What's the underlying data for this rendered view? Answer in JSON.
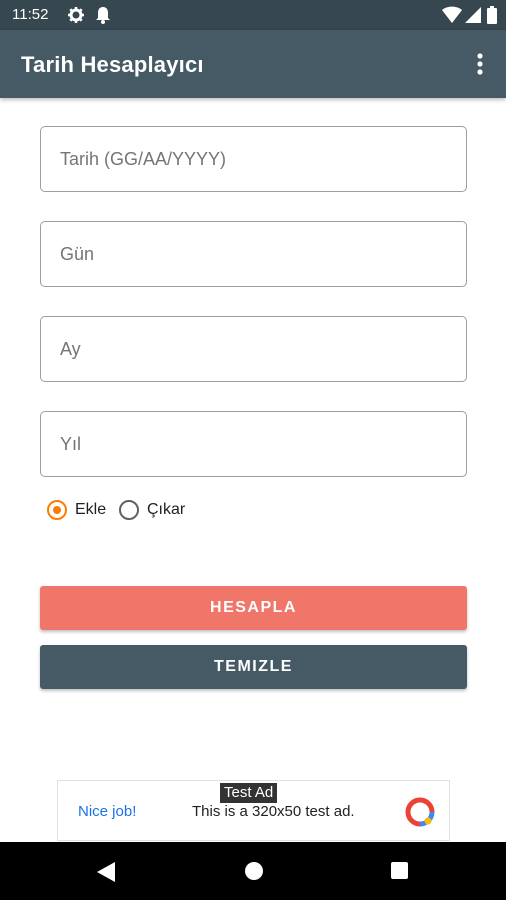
{
  "status_bar": {
    "time": "11:52",
    "icons": [
      "settings-icon",
      "notification-bell-icon",
      "wifi-icon",
      "signal-icon",
      "battery-icon"
    ]
  },
  "app_bar": {
    "title": "Tarih Hesaplayıcı",
    "menu_icon": "overflow-menu-icon"
  },
  "form": {
    "date_placeholder": "Tarih (GG/AA/YYYY)",
    "day_placeholder": "Gün",
    "month_placeholder": "Ay",
    "year_placeholder": "Yıl",
    "date_value": "",
    "day_value": "",
    "month_value": "",
    "year_value": "",
    "operation_options": [
      {
        "label": "Ekle",
        "selected": true
      },
      {
        "label": "Çıkar",
        "selected": false
      }
    ]
  },
  "buttons": {
    "calculate_label": "HESAPLA",
    "clear_label": "TEMIZLE"
  },
  "ad": {
    "badge": "Test Ad",
    "headline": "Nice job!",
    "text": "This is a 320x50 test ad."
  },
  "colors": {
    "app_bar": "#455a64",
    "status_bar": "#37474f",
    "accent": "#ff7b00",
    "primary_button": "#f0766a",
    "secondary_button": "#455a64"
  }
}
